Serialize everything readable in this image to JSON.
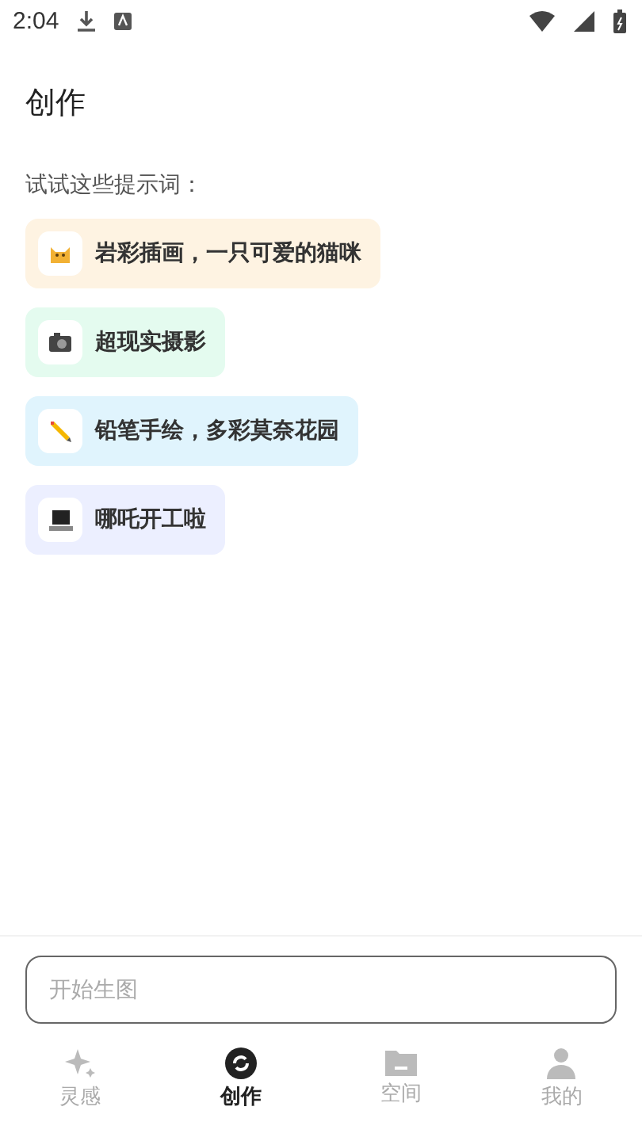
{
  "status_bar": {
    "time": "2:04"
  },
  "header": {
    "title": "创作"
  },
  "prompts": {
    "heading": "试试这些提示词：",
    "items": [
      {
        "kind": "cat",
        "text": "岩彩插画，一只可爱的猫咪",
        "color": "#fef3e2"
      },
      {
        "kind": "camera",
        "text": "超现实摄影",
        "color": "#e4fbef"
      },
      {
        "kind": "pencil",
        "text": "铅笔手绘，多彩莫奈花园",
        "color": "#e0f4fd"
      },
      {
        "kind": "laptop",
        "text": "哪吒开工啦",
        "color": "#ecefff"
      }
    ]
  },
  "composer": {
    "placeholder": "开始生图"
  },
  "nav": [
    {
      "kind": "sparkle",
      "label": "灵感",
      "selected": false
    },
    {
      "kind": "create",
      "label": "创作",
      "selected": true
    },
    {
      "kind": "folder",
      "label": "空间",
      "selected": false
    },
    {
      "kind": "person",
      "label": "我的",
      "selected": false
    }
  ]
}
